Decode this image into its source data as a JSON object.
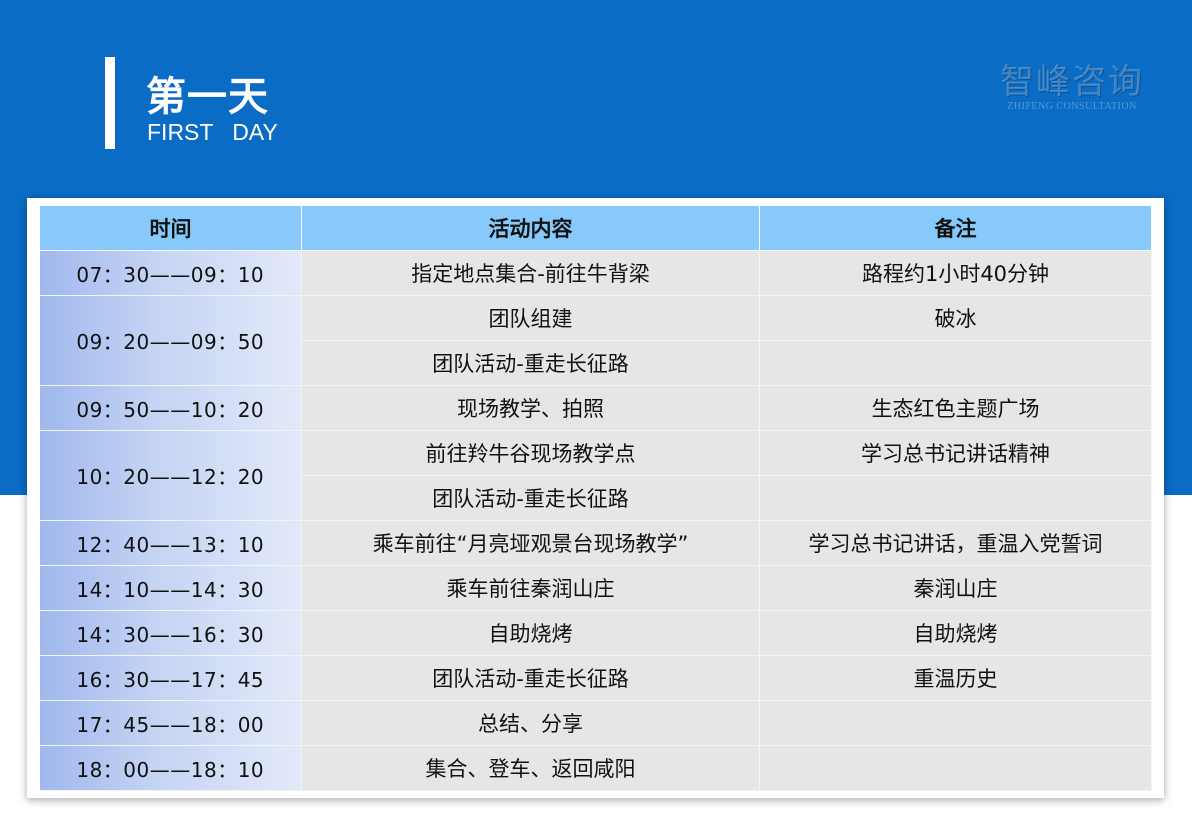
{
  "header": {
    "title_cn": "第一天",
    "title_en": "FIRST   DAY",
    "logo_cn": "智峰咨询",
    "logo_en": "ZHIFENG CONSULTATION"
  },
  "colors": {
    "banner": "#0a6cc4",
    "table_header": "#86c9fa",
    "time_gradient_start": "#a0b8ee",
    "cell_bg": "#e6e6e6"
  },
  "table": {
    "headers": [
      "时间",
      "活动内容",
      "备注"
    ],
    "rows": [
      {
        "time": "07：30——09：10",
        "activity": "指定地点集合-前往牛背梁",
        "note": "路程约1小时40分钟"
      },
      {
        "time": "09：20——09：50",
        "activity": "团队组建",
        "note": "破冰"
      },
      {
        "time": "",
        "activity": "团队活动-重走长征路",
        "note": ""
      },
      {
        "time": "09：50——10：20",
        "activity": "现场教学、拍照",
        "note": "生态红色主题广场"
      },
      {
        "time": "10：20——12：20",
        "activity": "前往羚牛谷现场教学点",
        "note": "学习总书记讲话精神"
      },
      {
        "time": "",
        "activity": "团队活动-重走长征路",
        "note": ""
      },
      {
        "time": "12：40——13：10",
        "activity": "乘车前往“月亮垭观景台现场教学”",
        "note": "学习总书记讲话，重温入党誓词"
      },
      {
        "time": "14：10——14：30",
        "activity": "乘车前往秦润山庄",
        "note": "秦润山庄"
      },
      {
        "time": "14：30——16：30",
        "activity": "自助烧烤",
        "note": "自助烧烤"
      },
      {
        "time": "16：30——17：45",
        "activity": "团队活动-重走长征路",
        "note": "重温历史"
      },
      {
        "time": "17：45——18：00",
        "activity": "总结、分享",
        "note": ""
      },
      {
        "time": "18：00——18：10",
        "activity": "集合、登车、返回咸阳",
        "note": ""
      }
    ]
  }
}
